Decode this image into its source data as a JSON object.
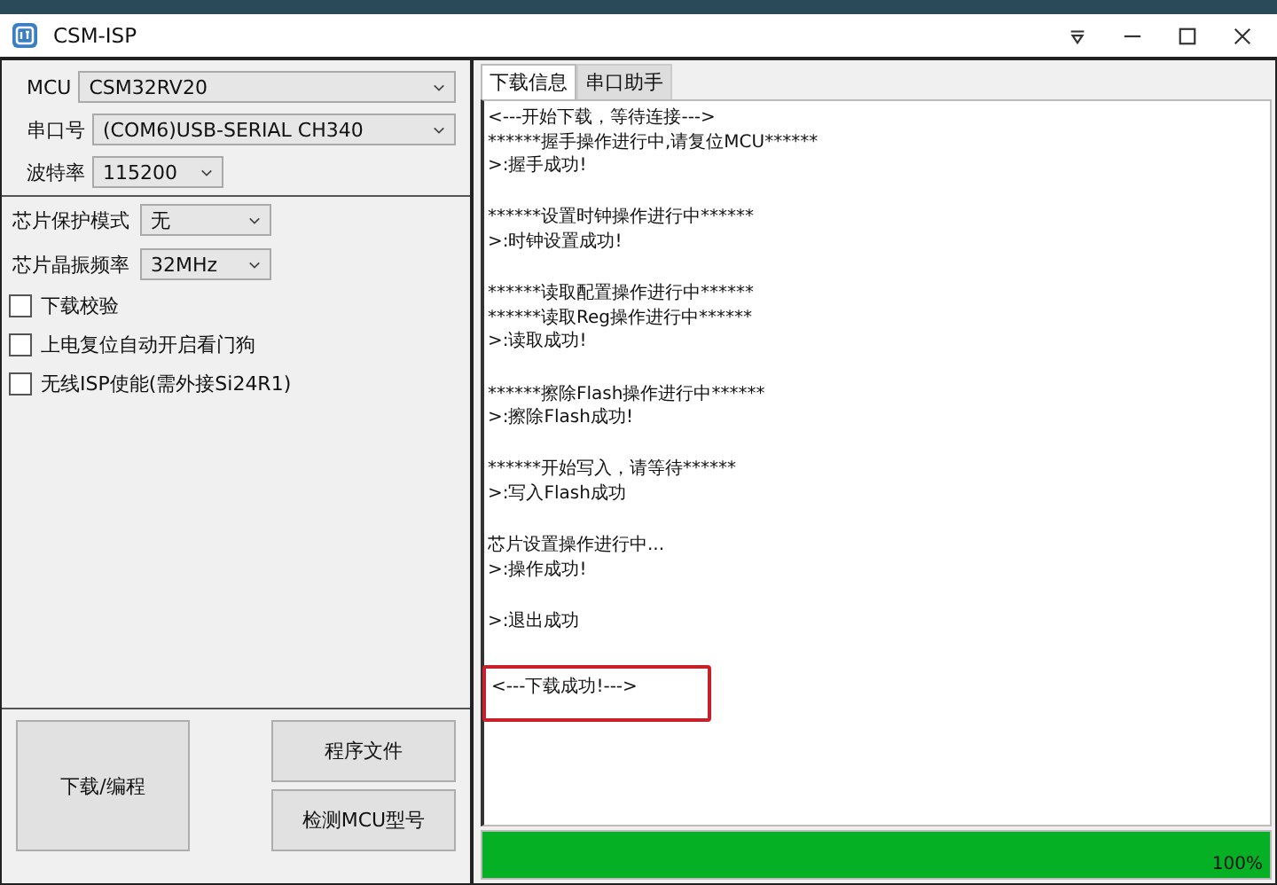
{
  "window": {
    "title": "CSM-ISP"
  },
  "connection": [
    {
      "label": "MCU",
      "value": "CSM32RV20",
      "kind": "wide"
    },
    {
      "label": "串口号",
      "value": "(COM6)USB-SERIAL CH340",
      "kind": "wide"
    },
    {
      "label": "波特率",
      "value": "115200",
      "kind": "narrow"
    }
  ],
  "options": [
    {
      "label": "芯片保护模式",
      "value": "无"
    },
    {
      "label": "芯片晶振频率",
      "value": "32MHz"
    }
  ],
  "checkboxes": [
    {
      "label": "下载校验",
      "checked": false
    },
    {
      "label": "上电复位自动开启看门狗",
      "checked": false
    },
    {
      "label": "无线ISP使能(需外接Si24R1)",
      "checked": false
    }
  ],
  "buttons": {
    "main": "下载/编程",
    "side": [
      "程序文件",
      "检测MCU型号"
    ]
  },
  "tabs": [
    {
      "label": "下载信息",
      "selected": true
    },
    {
      "label": "串口助手",
      "selected": false
    }
  ],
  "log": [
    {
      "lines": [
        "<---开始下载，等待连接--->",
        "******握手操作进行中,请复位MCU******",
        ">:握手成功!"
      ],
      "highlighted": false
    },
    {
      "lines": [
        "******设置时钟操作进行中******",
        ">:时钟设置成功!"
      ],
      "highlighted": false
    },
    {
      "lines": [
        "******读取配置操作进行中******",
        "******读取Reg操作进行中******",
        ">:读取成功!"
      ],
      "highlighted": false
    },
    {
      "lines": [
        "******擦除Flash操作进行中******",
        ">:擦除Flash成功!"
      ],
      "highlighted": false
    },
    {
      "lines": [
        "******开始写入，请等待******",
        ">:写入Flash成功"
      ],
      "highlighted": false
    },
    {
      "lines": [
        "芯片设置操作进行中...",
        ">:操作成功!"
      ],
      "highlighted": false
    },
    {
      "lines": [
        ">:退出成功"
      ],
      "highlighted": false
    },
    {
      "lines": [
        "<---下载成功!--->"
      ],
      "highlighted": true
    }
  ],
  "progress": {
    "level": 1,
    "reading": "100%"
  }
}
